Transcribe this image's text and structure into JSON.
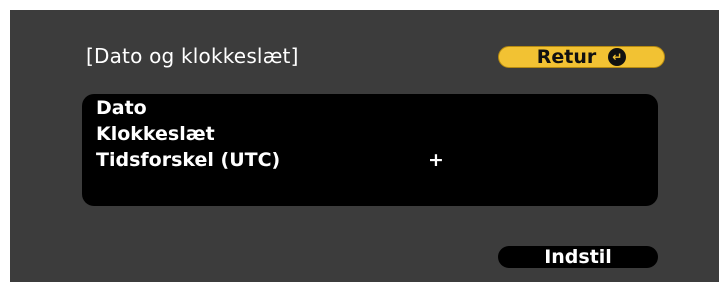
{
  "dialog": {
    "title": "[Dato og klokkeslæt]",
    "return_label": "Retur",
    "return_icon": "enter-icon",
    "set_label": "Indstil"
  },
  "settings": [
    {
      "label": "Dato",
      "value": ""
    },
    {
      "label": "Klokkeslæt",
      "value": ""
    },
    {
      "label": "Tidsforskel (UTC)",
      "value": "+"
    },
    {
      "label": "",
      "value": ""
    }
  ],
  "colors": {
    "background": "#3c3c3c",
    "highlight": "#f2c233",
    "panel": "#000000"
  }
}
